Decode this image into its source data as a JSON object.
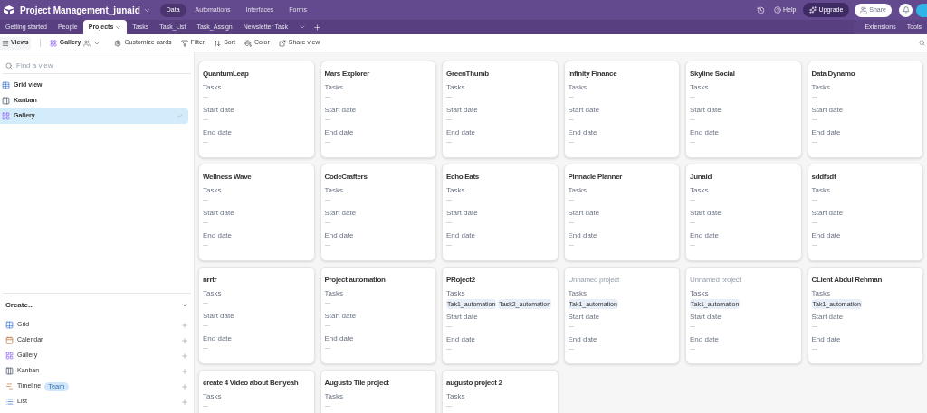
{
  "app": {
    "base_name": "Project Management_junaid",
    "nav": [
      {
        "label": "Data",
        "selected": true
      },
      {
        "label": "Automations",
        "selected": false
      },
      {
        "label": "Interfaces",
        "selected": false
      },
      {
        "label": "Forms",
        "selected": false
      }
    ],
    "help": "Help",
    "upgrade": "Upgrade",
    "share": "Share"
  },
  "tables": [
    {
      "label": "Getting started",
      "selected": false
    },
    {
      "label": "People",
      "selected": false
    },
    {
      "label": "Projects",
      "selected": true
    },
    {
      "label": "Tasks",
      "selected": false
    },
    {
      "label": "Task_List",
      "selected": false
    },
    {
      "label": "Task_Assign",
      "selected": false
    },
    {
      "label": "Newsletter Task",
      "selected": false
    }
  ],
  "table_tools": [
    "Extensions",
    "Tools"
  ],
  "toolbar": {
    "views": "Views",
    "view_name": "Gallery",
    "actions": [
      {
        "kind": "customize",
        "label": "Customize cards"
      },
      {
        "kind": "filter",
        "label": "Filter"
      },
      {
        "kind": "sort",
        "label": "Sort"
      },
      {
        "kind": "color",
        "label": "Color"
      },
      {
        "kind": "share",
        "label": "Share view"
      }
    ]
  },
  "sidebar": {
    "search": {
      "placeholder": "Find a view"
    },
    "views": [
      {
        "kind": "grid",
        "label": "Grid view",
        "selected": false
      },
      {
        "kind": "kanban",
        "label": "Kanban",
        "selected": false
      },
      {
        "kind": "gallery",
        "label": "Gallery",
        "selected": true
      }
    ],
    "create": {
      "title": "Create...",
      "items": [
        {
          "kind": "grid",
          "label": "Grid"
        },
        {
          "kind": "calendar",
          "label": "Calendar"
        },
        {
          "kind": "gallery",
          "label": "Gallery"
        },
        {
          "kind": "kanban",
          "label": "Kanban"
        },
        {
          "kind": "timeline",
          "label": "Timeline",
          "badge": "Team"
        },
        {
          "kind": "list",
          "label": "List"
        }
      ]
    }
  },
  "cards": [
    {
      "title": "QuantumLeap",
      "unnamed": false,
      "fields": [
        {
          "label": "Tasks"
        },
        {
          "label": "Start date"
        },
        {
          "label": "End date"
        }
      ]
    },
    {
      "title": "Mars Explorer",
      "unnamed": false,
      "fields": [
        {
          "label": "Tasks"
        },
        {
          "label": "Start date"
        },
        {
          "label": "End date"
        }
      ]
    },
    {
      "title": "GreenThumb",
      "unnamed": false,
      "fields": [
        {
          "label": "Tasks"
        },
        {
          "label": "Start date"
        },
        {
          "label": "End date"
        }
      ]
    },
    {
      "title": "Infinity Finance",
      "unnamed": false,
      "fields": [
        {
          "label": "Tasks"
        },
        {
          "label": "Start date"
        },
        {
          "label": "End date"
        }
      ]
    },
    {
      "title": "Skyline Social",
      "unnamed": false,
      "fields": [
        {
          "label": "Tasks"
        },
        {
          "label": "Start date"
        },
        {
          "label": "End date"
        }
      ]
    },
    {
      "title": "Data Dynamo",
      "unnamed": false,
      "fields": [
        {
          "label": "Tasks"
        },
        {
          "label": "Start date"
        },
        {
          "label": "End date"
        }
      ]
    },
    {
      "title": "Wellness Wave",
      "unnamed": false,
      "fields": [
        {
          "label": "Tasks"
        },
        {
          "label": "Start date"
        },
        {
          "label": "End date"
        }
      ]
    },
    {
      "title": "CodeCrafters",
      "unnamed": false,
      "fields": [
        {
          "label": "Tasks"
        },
        {
          "label": "Start date"
        },
        {
          "label": "End date"
        }
      ]
    },
    {
      "title": "Echo Eats",
      "unnamed": false,
      "fields": [
        {
          "label": "Tasks"
        },
        {
          "label": "Start date"
        },
        {
          "label": "End date"
        }
      ]
    },
    {
      "title": "Pinnacle Planner",
      "unnamed": false,
      "fields": [
        {
          "label": "Tasks"
        },
        {
          "label": "Start date"
        },
        {
          "label": "End date"
        }
      ]
    },
    {
      "title": "Junaid",
      "unnamed": false,
      "fields": [
        {
          "label": "Tasks"
        },
        {
          "label": "Start date"
        },
        {
          "label": "End date"
        }
      ]
    },
    {
      "title": "sddfsdf",
      "unnamed": false,
      "fields": [
        {
          "label": "Tasks"
        },
        {
          "label": "Start date"
        },
        {
          "label": "End date"
        }
      ]
    },
    {
      "title": "nrrtr",
      "unnamed": false,
      "fields": [
        {
          "label": "Tasks"
        },
        {
          "label": "Start date"
        },
        {
          "label": "End date"
        }
      ]
    },
    {
      "title": "Project automation",
      "unnamed": false,
      "fields": [
        {
          "label": "Tasks"
        },
        {
          "label": "Start date"
        },
        {
          "label": "End date"
        }
      ]
    },
    {
      "title": "PRoject2",
      "unnamed": false,
      "fields": [
        {
          "label": "Tasks",
          "chips": [
            "Tak1_automation",
            "Task2_automation"
          ]
        },
        {
          "label": "Start date"
        },
        {
          "label": "End date"
        }
      ]
    },
    {
      "title": "Unnamed project",
      "unnamed": true,
      "fields": [
        {
          "label": "Tasks",
          "chips": [
            "Tak1_automation"
          ]
        },
        {
          "label": "Start date"
        },
        {
          "label": "End date"
        }
      ]
    },
    {
      "title": "Unnamed project",
      "unnamed": true,
      "fields": [
        {
          "label": "Tasks",
          "chips": [
            "Tak1_automation"
          ]
        },
        {
          "label": "Start date"
        },
        {
          "label": "End date"
        }
      ]
    },
    {
      "title": "CLient Abdul Rehman",
      "unnamed": false,
      "fields": [
        {
          "label": "Tasks",
          "chips": [
            "Tak1_automation"
          ]
        },
        {
          "label": "Start date"
        },
        {
          "label": "End date"
        }
      ]
    },
    {
      "title": "create 4 Video about Benyeah",
      "unnamed": false,
      "fields": [
        {
          "label": "Tasks"
        }
      ]
    },
    {
      "title": "Augusto Tile project",
      "unnamed": false,
      "fields": [
        {
          "label": "Tasks"
        }
      ]
    },
    {
      "title": "augusto project 2",
      "unnamed": false,
      "fields": [
        {
          "label": "Tasks"
        }
      ]
    }
  ]
}
